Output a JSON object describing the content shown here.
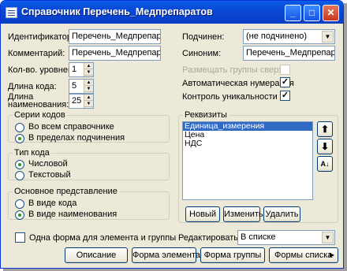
{
  "window": {
    "title": "Справочник Перечень_Медпрепаратов"
  },
  "fields": {
    "identifier_label": "Идентификатор:",
    "identifier_value": "Перечень_Медпрепаратов",
    "comment_label": "Комментарий:",
    "comment_value": "Перечень_Медпрепаратов",
    "levels_label": "Кол-во. уровней:",
    "levels_value": "1",
    "code_length_label": "Длина кода:",
    "code_length_value": "5",
    "name_length_label_1": "Длина",
    "name_length_label_2": "наименования:",
    "name_length_value": "25",
    "subordinate_label": "Подчинен:",
    "subordinate_value": "(не подчинено)",
    "synonym_label": "Синоним:",
    "synonym_value": "Перечень_Медпрепаратов"
  },
  "checks": {
    "groups_top": {
      "label": "Размещать группы сверху",
      "checked": false,
      "disabled": true
    },
    "auto_num": {
      "label": "Автоматическая нумерация",
      "checked": true
    },
    "unique": {
      "label": "Контроль уникальности",
      "checked": true
    },
    "one_form": {
      "label": "Одна форма для элемента и группы",
      "checked": false
    }
  },
  "groups": {
    "code_series": {
      "title": "Серии кодов",
      "options": [
        "Во всем справочнике",
        "В пределах подчинения"
      ],
      "selected": 1
    },
    "code_type": {
      "title": "Тип кода",
      "options": [
        "Числовой",
        "Текстовый"
      ],
      "selected": 0
    },
    "main_view": {
      "title": "Основное представление",
      "options": [
        "В виде кода",
        "В виде наименования"
      ],
      "selected": 1
    },
    "requisites": {
      "title": "Реквизиты",
      "items": [
        "Единица_измерения",
        "Цена",
        "НДС"
      ],
      "selected": 0
    }
  },
  "requisite_buttons": {
    "new": "Новый",
    "edit": "Изменить",
    "delete": "Удалить"
  },
  "edit_mode": {
    "label": "Редактировать:",
    "value": "В списке"
  },
  "bottom_buttons": {
    "description": "Описание",
    "element_form": "Форма элемента",
    "group_form": "Форма группы",
    "list_forms": "Формы списка"
  }
}
